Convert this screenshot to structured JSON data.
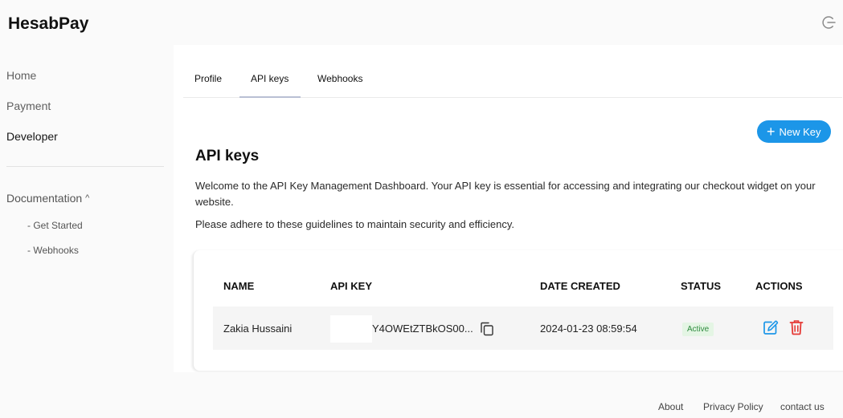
{
  "app": {
    "brand": "HesabPay"
  },
  "sidebar": {
    "items": [
      {
        "label": "Home"
      },
      {
        "label": "Payment"
      },
      {
        "label": "Developer"
      }
    ],
    "documentation": {
      "label": "Documentation",
      "subitems": [
        {
          "label": "Get Started"
        },
        {
          "label": "Webhooks"
        }
      ]
    }
  },
  "tabs": [
    {
      "label": "Profile"
    },
    {
      "label": "API keys",
      "active": true
    },
    {
      "label": "Webhooks"
    }
  ],
  "main": {
    "title": "API keys",
    "new_key_label": "New Key",
    "description1": "Welcome to the API Key Management Dashboard. Your API key is essential for accessing and integrating our checkout widget on your website.",
    "description2": "Please adhere to these guidelines to maintain security and efficiency."
  },
  "table": {
    "headers": {
      "name": "NAME",
      "api_key": "API KEY",
      "date": "DATE CREATED",
      "status": "STATUS",
      "actions": "ACTIONS"
    },
    "rows": [
      {
        "name": "Zakia Hussaini",
        "api_key": "Y4OWEtZTBkOS00...",
        "date": "2024-01-23 08:59:54",
        "status": "Active"
      }
    ]
  },
  "footer": {
    "about": "About",
    "privacy": "Privacy Policy",
    "contact": "contact us"
  },
  "colors": {
    "accent": "#1c96e8",
    "delete": "#e53935",
    "edit": "#1c96e8",
    "status_active": "#2e8b3e"
  },
  "icons": [
    "logout-icon",
    "chevron-up-icon",
    "plus-icon",
    "copy-icon",
    "edit-icon",
    "trash-icon"
  ]
}
